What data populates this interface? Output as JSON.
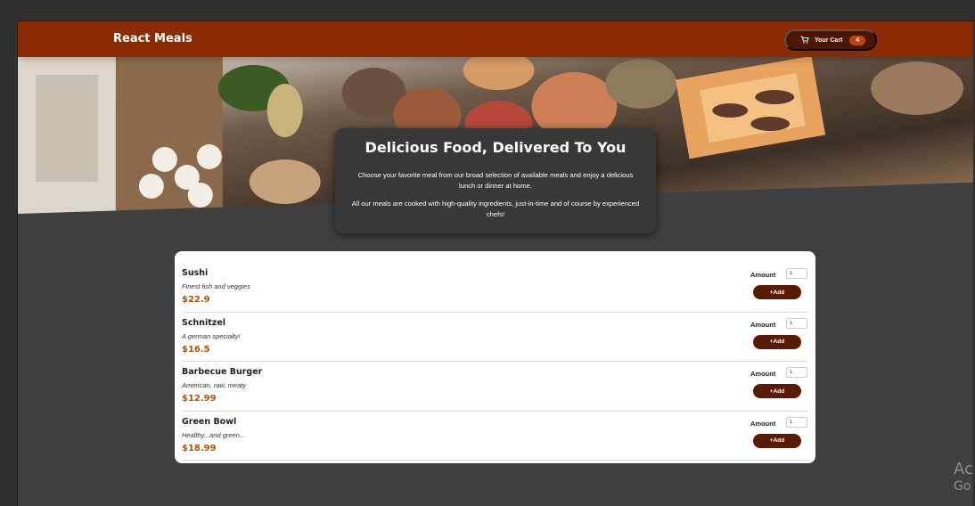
{
  "app": {
    "title": "React Meals"
  },
  "cart": {
    "label": "Your Cart",
    "count": "4",
    "icon": "cart-icon"
  },
  "summary": {
    "heading": "Delicious Food, Delivered To You",
    "paragraph1": "Choose your favorite meal from our broad selection of available meals and enjoy a delicious lunch or dinner at home.",
    "paragraph2": "All our meals are cooked with high-quality ingredients, just-in-time and of course by experienced chefs!"
  },
  "meals": [
    {
      "name": "Sushi",
      "description": "Finest fish and veggies",
      "price": "$22.9",
      "amount_label": "Amount",
      "amount_value": "1",
      "add_label": "+Add"
    },
    {
      "name": "Schnitzel",
      "description": "A german specialty!",
      "price": "$16.5",
      "amount_label": "Amount",
      "amount_value": "1",
      "add_label": "+Add"
    },
    {
      "name": "Barbecue Burger",
      "description": "American, raw, meaty",
      "price": "$12.99",
      "amount_label": "Amount",
      "amount_value": "1",
      "add_label": "+Add"
    },
    {
      "name": "Green Bowl",
      "description": "Healthy...and green...",
      "price": "$18.99",
      "amount_label": "Amount",
      "amount_value": "1",
      "add_label": "+Add"
    }
  ],
  "overlay": {
    "line1": "Ac",
    "line2": "Go"
  },
  "colors": {
    "header": "#8a2b06",
    "cart_button": "#4d1601",
    "badge": "#b94517",
    "price": "#ad5502",
    "add_button": "#5a1a03"
  }
}
